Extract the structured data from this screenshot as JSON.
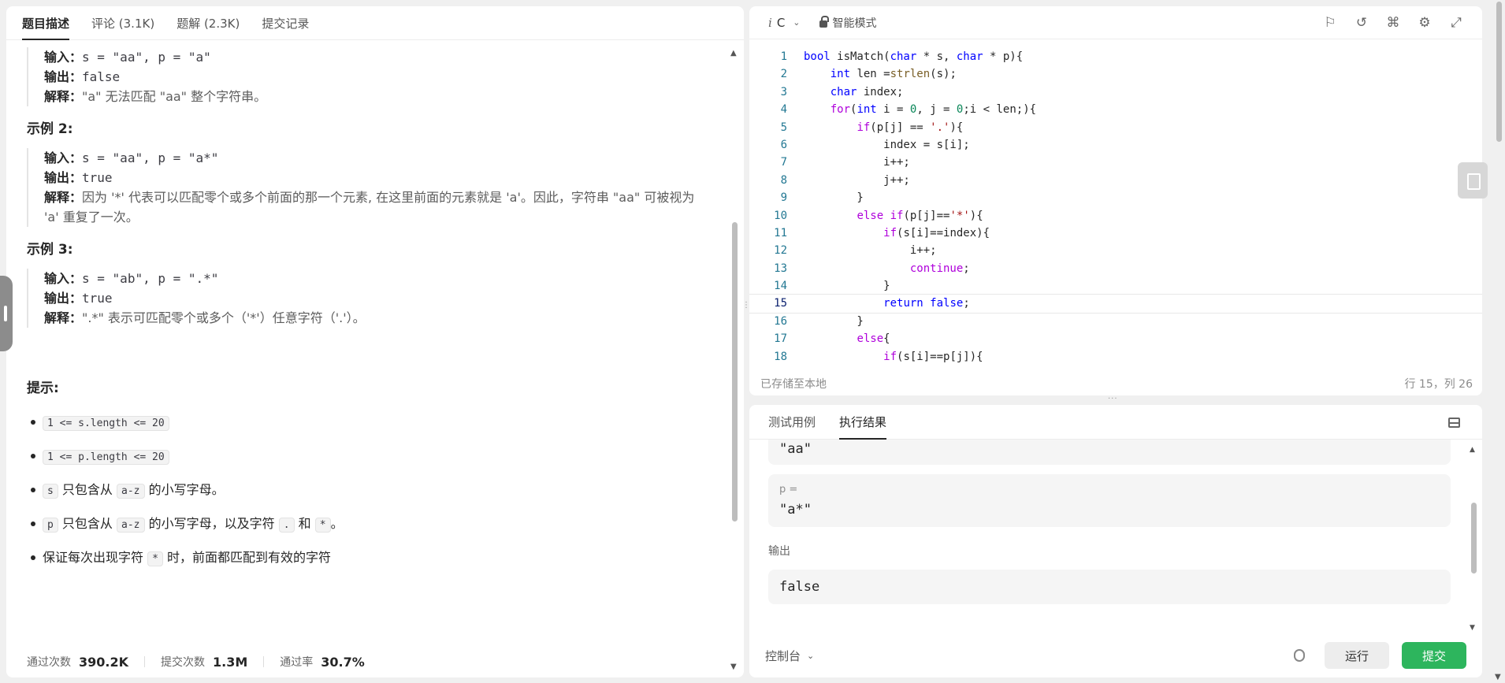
{
  "left": {
    "tabs": [
      "题目描述",
      "评论 (3.1K)",
      "题解 (2.3K)",
      "提交记录"
    ],
    "example1": {
      "input_label": "输入：",
      "input": "s = \"aa\", p = \"a\"",
      "output_label": "输出：",
      "output": "false",
      "explain_label": "解释：",
      "explain": "\"a\" 无法匹配 \"aa\" 整个字符串。"
    },
    "example2_title": "示例 2:",
    "example2": {
      "input_label": "输入：",
      "input": "s = \"aa\", p = \"a*\"",
      "output_label": "输出：",
      "output": "true",
      "explain_label": "解释：",
      "explain": "因为 '*' 代表可以匹配零个或多个前面的那一个元素, 在这里前面的元素就是 'a'。因此，字符串 \"aa\" 可被视为 'a' 重复了一次。"
    },
    "example3_title": "示例 3:",
    "example3": {
      "input_label": "输入：",
      "input": "s = \"ab\", p = \".*\"",
      "output_label": "输出：",
      "output": "true",
      "explain_label": "解释：",
      "explain": "\".*\" 表示可匹配零个或多个（'*'）任意字符（'.'）。"
    },
    "hints_title": "提示:",
    "hints": {
      "h1_code": "1 <= s.length <= 20",
      "h2_code": "1 <= p.length <= 20",
      "h3_code": "s",
      "h3_text": "只包含从",
      "h3_code2": "a-z",
      "h3_text2": "的小写字母。",
      "h4_code": "p",
      "h4_text": "只包含从",
      "h4_code2": "a-z",
      "h4_text2": "的小写字母，以及字符",
      "h4_code3": ".",
      "h4_text3": "和",
      "h4_code4": "*",
      "h4_text4": "。",
      "h5_text": "保证每次出现字符",
      "h5_code": "*",
      "h5_text2": "时，前面都匹配到有效的字符"
    },
    "stats": {
      "pass_label": "通过次数",
      "pass": "390.2K",
      "submit_label": "提交次数",
      "submit": "1.3M",
      "rate_label": "通过率",
      "rate": "30.7%"
    }
  },
  "editor": {
    "language": "C",
    "mode": "智能模式",
    "icons": [
      "bookmark-icon",
      "reset-icon",
      "command-icon",
      "settings-icon",
      "fullscreen-icon"
    ],
    "current_line": 15,
    "saved_status": "已存储至本地",
    "cursor_pos": "行 15，列 26",
    "code_lines": [
      "bool isMatch(char * s, char * p){",
      "    int len =strlen(s);",
      "    char index;",
      "    for(int i = 0, j = 0;i < len;){",
      "        if(p[j] == '.'){",
      "            index = s[i];",
      "            i++;",
      "            j++;",
      "        }",
      "        else if(p[j]=='*'){",
      "            if(s[i]==index){",
      "                i++;",
      "                continue;",
      "            }",
      "            return false;",
      "        }",
      "        else{",
      "            if(s[i]==p[j]){"
    ]
  },
  "result": {
    "tabs": [
      "测试用例",
      "执行结果"
    ],
    "s_value": "\"aa\"",
    "p_label": "p =",
    "p_value": "\"a*\"",
    "output_label": "输出",
    "output_value": "false",
    "console_label": "控制台",
    "run_label": "运行",
    "submit_label": "提交",
    "colors": {
      "submit": "#2db55d"
    }
  }
}
